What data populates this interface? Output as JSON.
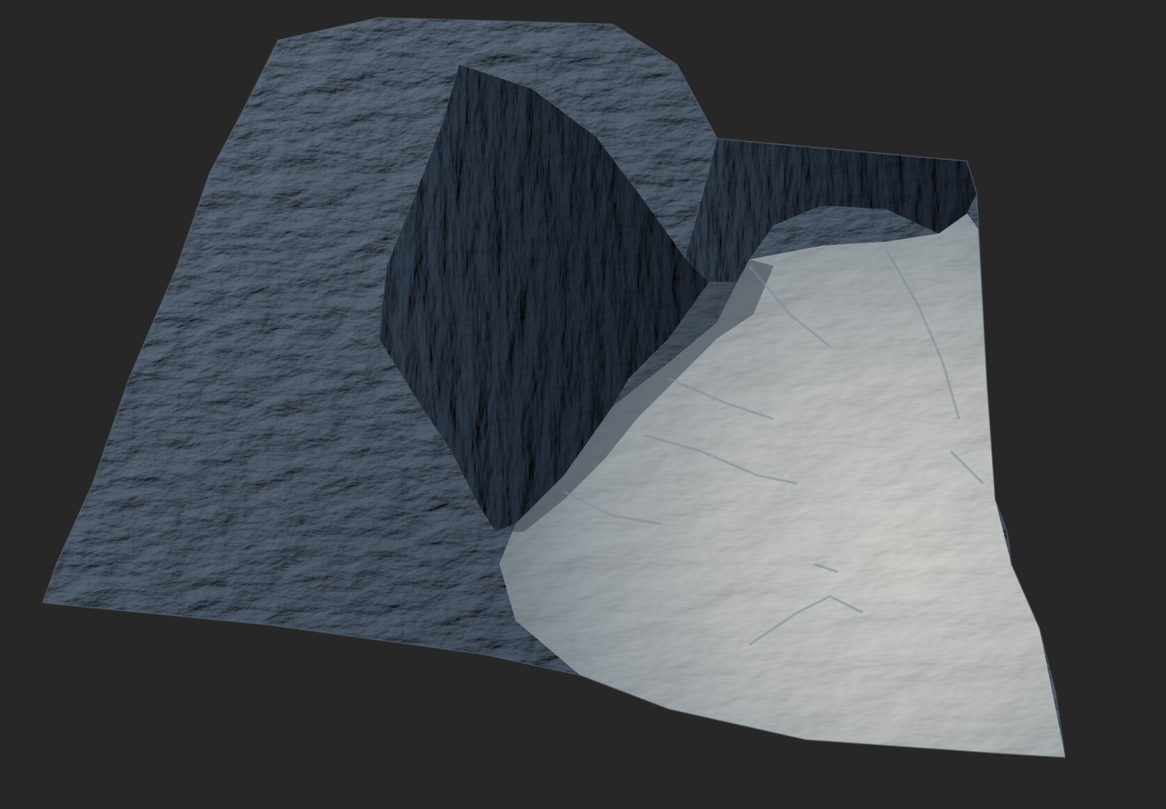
{
  "scene": {
    "background_color": "#272727",
    "subject": "terrain-heightmap-render",
    "palette": {
      "rock_dark": "#3a4350",
      "rock_mid": "#5c6776",
      "rock_light": "#8a95a3",
      "snow_shadow": "#9aa3ad",
      "snow_mid": "#c3c8cc",
      "snow_light": "#dcdfdf",
      "cliff_shadow": "#2f3640"
    }
  }
}
